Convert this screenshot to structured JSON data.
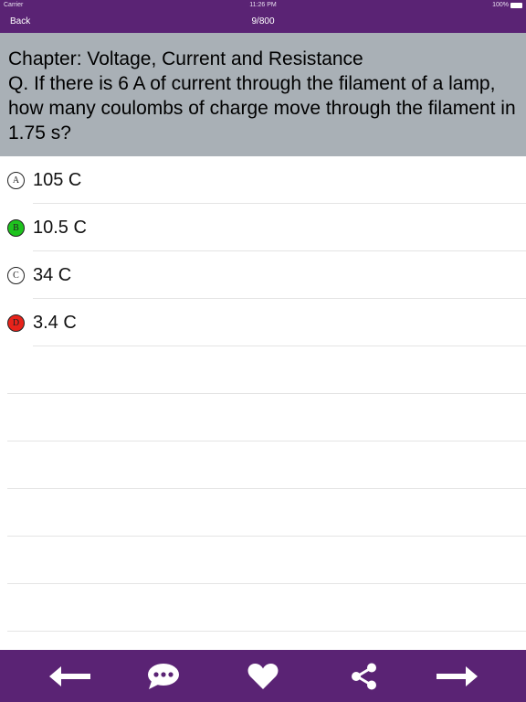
{
  "status_bar": {
    "carrier": "Carrier",
    "time": "11:26 PM",
    "battery": "100%"
  },
  "nav": {
    "back_label": "Back",
    "counter": "9/800"
  },
  "question": {
    "chapter": "Chapter: Voltage, Current and Resistance",
    "text": "Q. If there is 6 A of current through the filament of a lamp, how many coulombs of charge move through the filament in 1.75 s?"
  },
  "answers": [
    {
      "letter": "A",
      "text": "105 C",
      "state": "neutral",
      "color": "#ffffff"
    },
    {
      "letter": "B",
      "text": "10.5 C",
      "state": "correct",
      "color": "#1ec31e"
    },
    {
      "letter": "C",
      "text": "34 C",
      "state": "neutral",
      "color": "#ffffff"
    },
    {
      "letter": "D",
      "text": "3.4 C",
      "state": "wrong",
      "color": "#e8231b"
    }
  ],
  "toolbar": {
    "icons": [
      "arrow-left-icon",
      "chat-bubble-icon",
      "heart-icon",
      "share-icon",
      "arrow-right-icon"
    ]
  },
  "colors": {
    "brand": "#5a2374",
    "question_bg": "#a9b0b6",
    "correct": "#1ec31e",
    "wrong": "#e8231b"
  }
}
